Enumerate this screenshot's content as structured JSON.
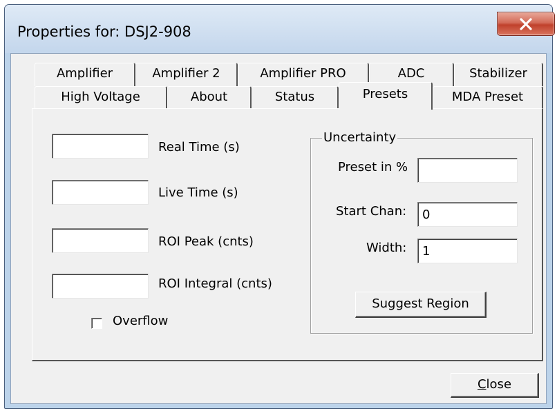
{
  "window": {
    "title": "Properties for: DSJ2-908"
  },
  "tabs": {
    "row1": [
      "Amplifier",
      "Amplifier 2",
      "Amplifier PRO",
      "ADC",
      "Stabilizer"
    ],
    "row2": [
      "High Voltage",
      "About",
      "Status",
      "Presets",
      "MDA Preset"
    ],
    "active": "Presets"
  },
  "presets": {
    "real_time_label": "Real Time (s)",
    "live_time_label": "Live Time (s)",
    "roi_peak_label": "ROI Peak (cnts)",
    "roi_integral_label": "ROI Integral (cnts)",
    "real_time_value": "",
    "live_time_value": "",
    "roi_peak_value": "",
    "roi_integral_value": "",
    "overflow_label": "Overflow",
    "overflow_checked": false
  },
  "uncertainty": {
    "title": "Uncertainty",
    "preset_label": "Preset in %",
    "preset_value": "",
    "start_chan_label": "Start Chan:",
    "start_chan_value": "0",
    "width_label": "Width:",
    "width_value": "1",
    "suggest_button": "Suggest Region"
  },
  "footer": {
    "close_mnemonic": "C",
    "close_rest": "lose"
  },
  "colors": {
    "close_button_red": "#c9503a",
    "dialog_bg": "#f0f0f0",
    "frame": "#bcd3ea"
  }
}
